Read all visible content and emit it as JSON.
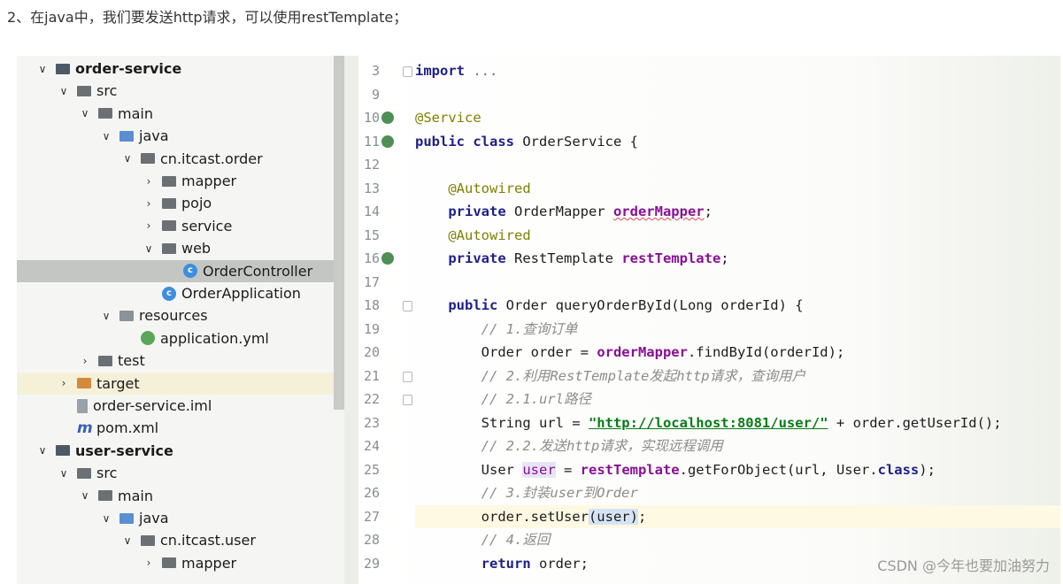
{
  "caption": "2、在java中，我们要发送http请求，可以使用restTemplate；",
  "watermark": "CSDN @今年也要加油努力",
  "tree": [
    {
      "label": "order-service",
      "arrow": "∨",
      "icon": "fm",
      "bold": true,
      "indent": 0
    },
    {
      "label": "src",
      "arrow": "∨",
      "icon": "f",
      "indent": 1
    },
    {
      "label": "main",
      "arrow": "∨",
      "icon": "f",
      "indent": 2
    },
    {
      "label": "java",
      "arrow": "∨",
      "icon": "fb",
      "indent": 3
    },
    {
      "label": "cn.itcast.order",
      "arrow": "∨",
      "icon": "f",
      "indent": 4
    },
    {
      "label": "mapper",
      "arrow": "›",
      "icon": "f",
      "indent": 5
    },
    {
      "label": "pojo",
      "arrow": "›",
      "icon": "f",
      "indent": 5
    },
    {
      "label": "service",
      "arrow": "›",
      "icon": "f",
      "indent": 5
    },
    {
      "label": "web",
      "arrow": "∨",
      "icon": "f",
      "indent": 5
    },
    {
      "label": "OrderController",
      "arrow": "",
      "icon": "circ",
      "indent": 6,
      "selected": true
    },
    {
      "label": "OrderApplication",
      "arrow": "",
      "icon": "circ",
      "indent": 5
    },
    {
      "label": "resources",
      "arrow": "∨",
      "icon": "fr",
      "indent": 3
    },
    {
      "label": "application.yml",
      "arrow": "",
      "icon": "leaf",
      "indent": 4
    },
    {
      "label": "test",
      "arrow": "›",
      "icon": "f",
      "indent": 2
    },
    {
      "label": "target",
      "arrow": "›",
      "icon": "fo",
      "indent": 1,
      "target": true
    },
    {
      "label": "order-service.iml",
      "arrow": "",
      "icon": "file",
      "indent": 1
    },
    {
      "label": "pom.xml",
      "arrow": "",
      "icon": "m",
      "indent": 1
    },
    {
      "label": "user-service",
      "arrow": "∨",
      "icon": "fm",
      "bold": true,
      "indent": 0
    },
    {
      "label": "src",
      "arrow": "∨",
      "icon": "f",
      "indent": 1
    },
    {
      "label": "main",
      "arrow": "∨",
      "icon": "f",
      "indent": 2
    },
    {
      "label": "java",
      "arrow": "∨",
      "icon": "fb",
      "indent": 3
    },
    {
      "label": "cn.itcast.user",
      "arrow": "∨",
      "icon": "f",
      "indent": 4
    },
    {
      "label": "mapper",
      "arrow": "›",
      "icon": "f",
      "indent": 5
    }
  ],
  "code": [
    {
      "n": "3",
      "fold": true,
      "parts": [
        [
          "kw",
          "import "
        ],
        [
          "dim",
          "..."
        ]
      ]
    },
    {
      "n": "9",
      "parts": []
    },
    {
      "n": "10",
      "gicon": true,
      "parts": [
        [
          "ann",
          "@Service"
        ]
      ]
    },
    {
      "n": "11",
      "gicon": true,
      "parts": [
        [
          "kw",
          "public class "
        ],
        [
          "",
          "OrderService {"
        ]
      ]
    },
    {
      "n": "12",
      "parts": []
    },
    {
      "n": "13",
      "parts": [
        [
          "",
          "    "
        ],
        [
          "ann",
          "@Autowired"
        ]
      ]
    },
    {
      "n": "14",
      "parts": [
        [
          "",
          "    "
        ],
        [
          "kw",
          "private "
        ],
        [
          "",
          "OrderMapper "
        ],
        [
          "fld squig",
          "orderMapper"
        ],
        [
          "",
          ";"
        ]
      ]
    },
    {
      "n": "15",
      "parts": [
        [
          "",
          "    "
        ],
        [
          "ann",
          "@Autowired"
        ]
      ]
    },
    {
      "n": "16",
      "gicon": true,
      "parts": [
        [
          "",
          "    "
        ],
        [
          "kw",
          "private "
        ],
        [
          "",
          "RestTemplate "
        ],
        [
          "fld",
          "restTemplate"
        ],
        [
          "",
          ";"
        ]
      ]
    },
    {
      "n": "17",
      "parts": []
    },
    {
      "n": "18",
      "fold": true,
      "parts": [
        [
          "",
          "    "
        ],
        [
          "kw",
          "public "
        ],
        [
          "",
          "Order queryOrderById(Long orderId) {"
        ]
      ]
    },
    {
      "n": "19",
      "parts": [
        [
          "",
          "        "
        ],
        [
          "cmt",
          "// 1.查询订单"
        ]
      ]
    },
    {
      "n": "20",
      "parts": [
        [
          "",
          "        Order order = "
        ],
        [
          "fld",
          "orderMapper"
        ],
        [
          "",
          ".findById(orderId);"
        ]
      ]
    },
    {
      "n": "21",
      "fold": true,
      "parts": [
        [
          "",
          "        "
        ],
        [
          "cmt",
          "// 2.利用RestTemplate发起http请求，查询用户"
        ]
      ]
    },
    {
      "n": "22",
      "fold": true,
      "parts": [
        [
          "",
          "        "
        ],
        [
          "cmt",
          "// 2.1.url路径"
        ]
      ]
    },
    {
      "n": "23",
      "parts": [
        [
          "",
          "        String url = "
        ],
        [
          "str",
          "\"http://localhost:8081/user/\""
        ],
        [
          "",
          " + order.getUserId();"
        ]
      ]
    },
    {
      "n": "24",
      "parts": [
        [
          "",
          "        "
        ],
        [
          "cmt",
          "// 2.2.发送http请求，实现远程调用"
        ]
      ]
    },
    {
      "n": "25",
      "parts": [
        [
          "",
          "        User "
        ],
        [
          "hl",
          "user"
        ],
        [
          "",
          " = "
        ],
        [
          "fld",
          "restTemplate"
        ],
        [
          "",
          ".getForObject(url, User."
        ],
        [
          "kw",
          "class"
        ],
        [
          "",
          ");"
        ]
      ]
    },
    {
      "n": "26",
      "parts": [
        [
          "",
          "        "
        ],
        [
          "cmt",
          "// 3.封装user到Order"
        ]
      ]
    },
    {
      "n": "27",
      "current": true,
      "parts": [
        [
          "",
          "        order.setUser"
        ],
        [
          "hlb",
          "(user)"
        ],
        [
          "",
          ";"
        ]
      ]
    },
    {
      "n": "28",
      "parts": [
        [
          "",
          "        "
        ],
        [
          "cmt",
          "// 4.返回"
        ]
      ]
    },
    {
      "n": "29",
      "parts": [
        [
          "",
          "        "
        ],
        [
          "kw",
          "return "
        ],
        [
          "",
          "order;"
        ]
      ]
    }
  ]
}
